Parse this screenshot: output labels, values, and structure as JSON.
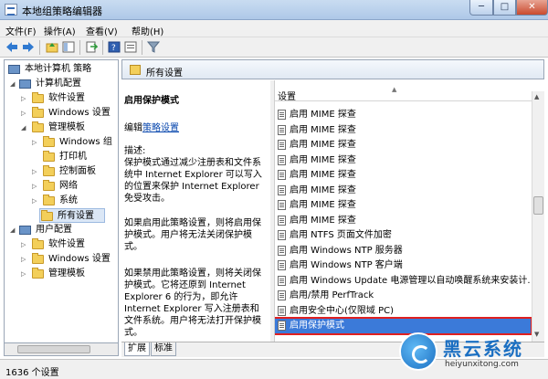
{
  "window": {
    "title": "本地组策略编辑器",
    "min": "─",
    "max": "□",
    "close": "✕"
  },
  "menu": [
    "文件(F)",
    "操作(A)",
    "查看(V)",
    "帮助(H)"
  ],
  "tree": {
    "root": "本地计算机 策略",
    "computer_config": "计算机配置",
    "software_settings": "软件设置",
    "windows_settings": "Windows 设置",
    "admin_templates": "管理模板",
    "windows_components": "Windows 组",
    "printers": "打印机",
    "control_panel": "控制面板",
    "network": "网络",
    "system": "系统",
    "all_settings": "所有设置",
    "user_config": "用户配置",
    "user_software": "软件设置",
    "user_windows": "Windows 设置",
    "user_admin": "管理模板"
  },
  "header": {
    "title": "所有设置"
  },
  "description": {
    "title": "启用保护模式",
    "edit_prefix": "编辑",
    "edit_link": "策略设置",
    "desc_label": "描述:",
    "p1": "保护模式通过减少注册表和文件系统中 Internet Explorer 可以写入的位置来保护 Internet Explorer 免受攻击。",
    "p2": "如果启用此策略设置，则将启用保护模式。用户将无法关闭保护模式。",
    "p3": "如果禁用此策略设置，则将关闭保护模式。它将还原到 Internet Explorer 6 的行为，即允许 Internet Explorer 写入注册表和文件系统。用户将无法打开保护模式。"
  },
  "list": {
    "column": "设置",
    "rows": [
      "启用 MIME 探查",
      "启用 MIME 探查",
      "启用 MIME 探查",
      "启用 MIME 探查",
      "启用 MIME 探查",
      "启用 MIME 探查",
      "启用 MIME 探查",
      "启用 MIME 探查",
      "启用 NTFS 页面文件加密",
      "启用 Windows NTP 服务器",
      "启用 Windows NTP 客户端",
      "启用 Windows Update 电源管理以自动唤醒系统来安装计...",
      "启用/禁用 PerfTrack",
      "启用安全中心(仅限域 PC)",
      "启用保护模式"
    ],
    "selected_index": 14
  },
  "tabs": [
    "扩展",
    "标准"
  ],
  "status": "1636 个设置",
  "watermark": {
    "title": "黑云系统",
    "url": "heiyunxitong.com"
  }
}
